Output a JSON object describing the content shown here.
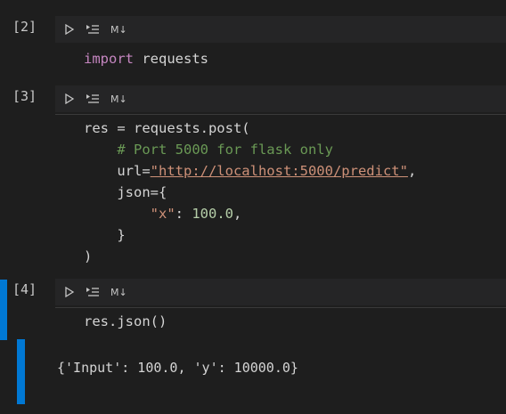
{
  "cells": [
    {
      "exec_count": "[2]",
      "markdown_label": "M↓",
      "code_lines": [
        [
          {
            "t": "import",
            "c": "kw-import"
          },
          {
            "t": " requests",
            "c": "kw-plain"
          }
        ]
      ]
    },
    {
      "exec_count": "[3]",
      "markdown_label": "M↓",
      "code_lines": [
        [
          {
            "t": "res = requests.post(",
            "c": "kw-plain"
          }
        ],
        [
          {
            "t": "    # Port 5000 for flask only",
            "c": "comment"
          }
        ],
        [
          {
            "t": "    url=",
            "c": "kw-plain"
          },
          {
            "t": "\"http://localhost:5000/predict\"",
            "c": "url"
          },
          {
            "t": ",",
            "c": "kw-plain"
          }
        ],
        [
          {
            "t": "    json={",
            "c": "kw-plain"
          }
        ],
        [
          {
            "t": "        ",
            "c": "kw-plain"
          },
          {
            "t": "\"x\"",
            "c": "str"
          },
          {
            "t": ": ",
            "c": "kw-plain"
          },
          {
            "t": "100.0",
            "c": "num"
          },
          {
            "t": ",",
            "c": "kw-plain"
          }
        ],
        [
          {
            "t": "    }",
            "c": "kw-plain"
          }
        ],
        [
          {
            "t": ")",
            "c": "kw-plain"
          }
        ]
      ]
    },
    {
      "exec_count": "[4]",
      "markdown_label": "M↓",
      "code_lines": [
        [
          {
            "t": "res.json()",
            "c": "kw-plain"
          }
        ]
      ],
      "output": "{'Input': 100.0, 'y': 10000.0}"
    }
  ],
  "colors": {
    "accent": "#0078d4",
    "background": "#1e1e1e",
    "toolbar": "#252526"
  },
  "icons": [
    "run-cell-icon",
    "run-below-icon"
  ]
}
